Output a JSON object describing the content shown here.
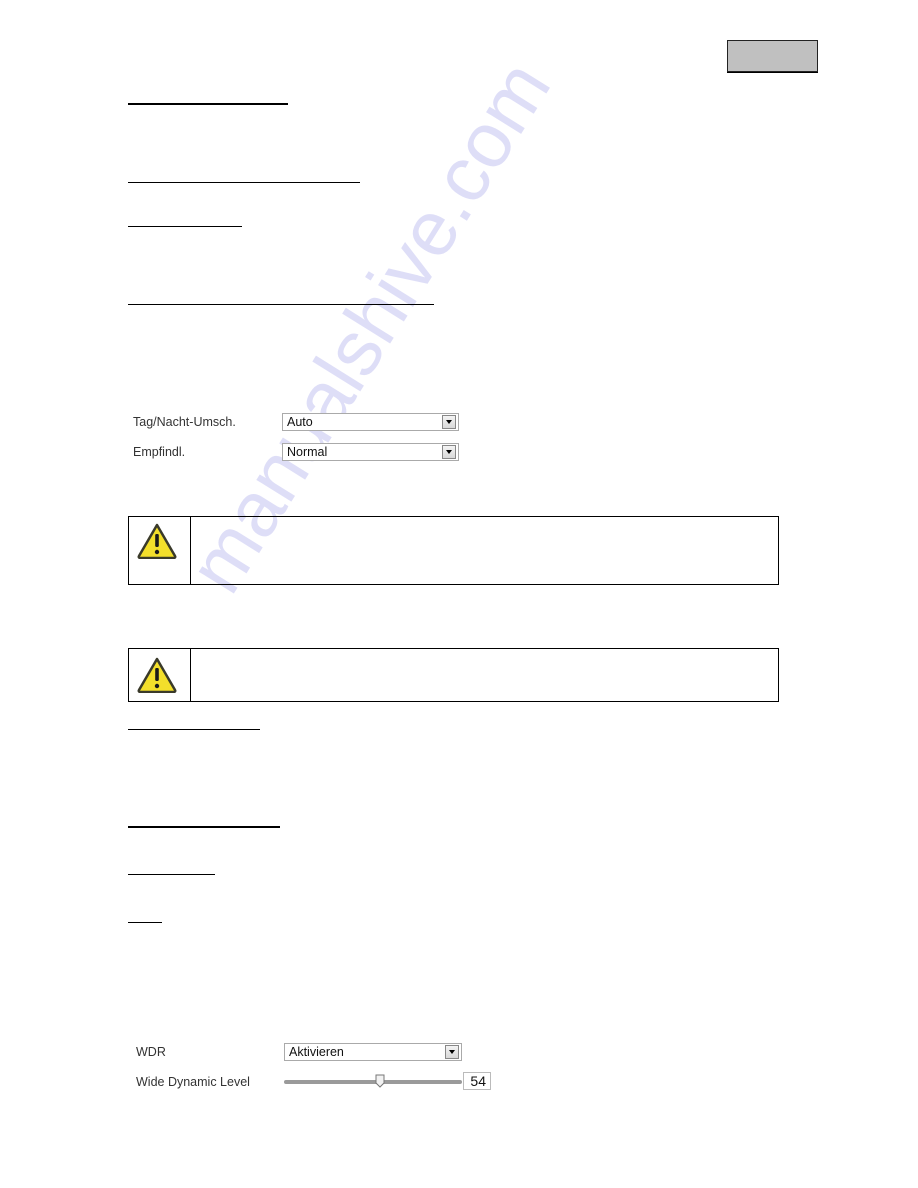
{
  "watermark": {
    "text": "manualshive.com",
    "color": "#c9c9f3"
  },
  "page_tab": {
    "color": "#c0c0c0"
  },
  "day_night_form": {
    "fields": [
      {
        "label": "Tag/Nacht-Umsch.",
        "value": "Auto"
      },
      {
        "label": "Empfindl.",
        "value": "Normal"
      }
    ]
  },
  "warnings": [
    {
      "icon": "warning-triangle-icon",
      "text": ""
    },
    {
      "icon": "warning-triangle-icon",
      "text": ""
    }
  ],
  "wdr_form": {
    "wdr_label": "WDR",
    "wdr_value": "Aktivieren",
    "level_label": "Wide Dynamic Level",
    "level_value": "54",
    "level_fraction": 0.54
  }
}
